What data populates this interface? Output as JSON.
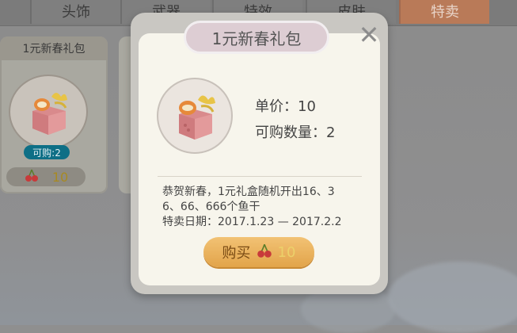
{
  "tabs": [
    {
      "label": "头饰"
    },
    {
      "label": "武器"
    },
    {
      "label": "特效"
    },
    {
      "label": "皮肤"
    },
    {
      "label": "特卖",
      "active": true
    }
  ],
  "left_card": {
    "title": "1元新春礼包",
    "badge": "可购:2",
    "price": "10"
  },
  "modal": {
    "title": "1元新春礼包",
    "unit_price": "单价：10",
    "purchasable": "可购数量：2",
    "description_line1": "恭贺新春，1元礼盒随机开出16、3",
    "description_line2": "6、66、666个鱼干",
    "sale_date": "特卖日期：2017.1.23 — 2017.2.2",
    "buy_label": "购买",
    "buy_price": "10"
  },
  "icons": {
    "close": "close-icon",
    "currency": "cherry-icon",
    "item": "gift-box-icon"
  },
  "colors": {
    "active_tab": "#b97a58",
    "badge": "#0e6f86",
    "buy_button": "#e9b35d",
    "title_pill": "#ddcdd3"
  }
}
